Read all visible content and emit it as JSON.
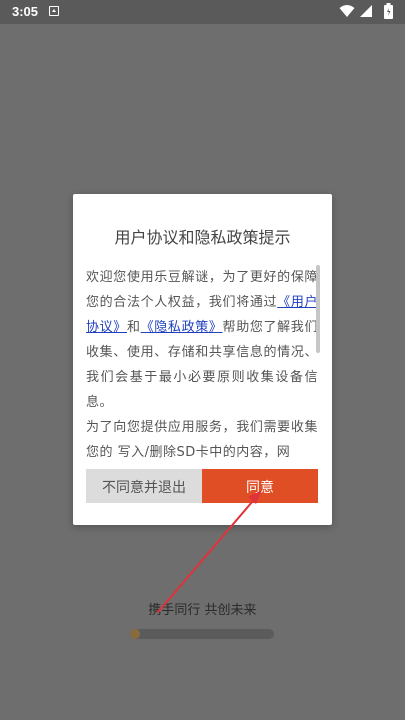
{
  "status_bar": {
    "time": "3:05",
    "icons": [
      "notification-icon",
      "wifi-icon",
      "signal-icon",
      "battery-icon"
    ]
  },
  "dialog": {
    "title": "用户协议和隐私政策提示",
    "body_intro": "欢迎您使用乐豆解谜，为了更好的保障您的合法个人权益，我们将通过",
    "link_user_agreement": "《用户协议》",
    "conjunction": "和",
    "link_privacy_policy": "《隐私政策》",
    "body_after_links": "帮助您了解我们收集、使用、存储和共享信息的情况、我们会基于最小必要原则收集设备信息。",
    "body_paragraph_2": "为了向您提供应用服务，我们需要收集您的 写入/删除SD卡中的内容，网",
    "disagree_label": "不同意并退出",
    "agree_label": "同意"
  },
  "splash": {
    "slogan": "携手同行 共创未来",
    "progress_fraction": 0.07
  },
  "colors": {
    "backdrop": "#6e6e6e",
    "agree_button": "#e04e25",
    "disagree_button": "#dcdcdc",
    "link": "#1f3fbf",
    "progress_fill": "#8a6b3e",
    "annotation_arrow": "#e0323a"
  }
}
